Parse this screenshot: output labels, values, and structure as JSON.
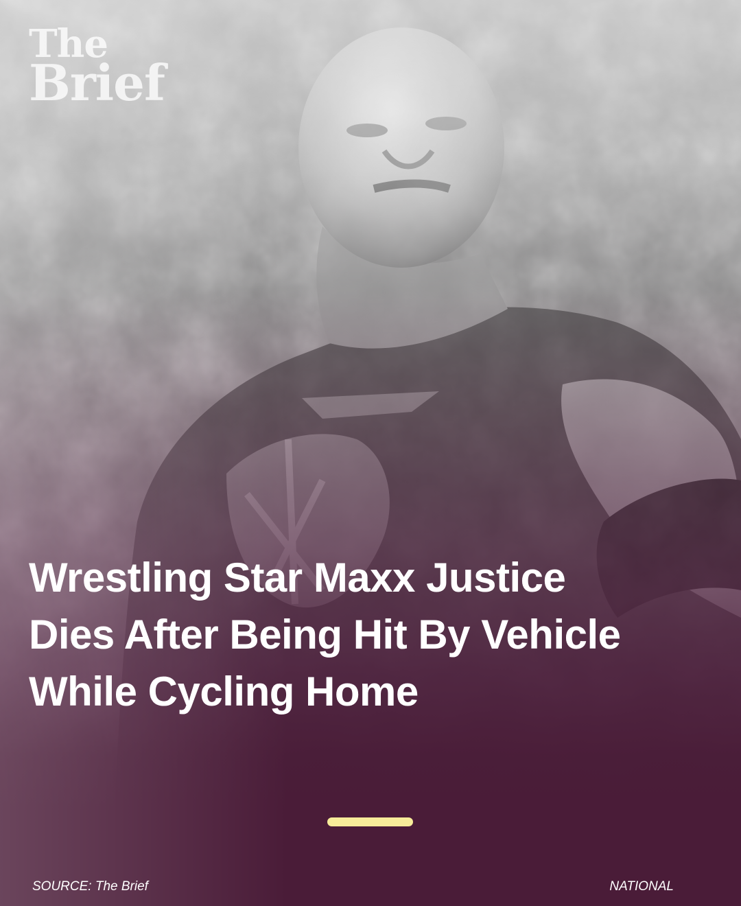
{
  "brand": {
    "logo_line1": "The",
    "logo_line2": "Brief"
  },
  "article": {
    "headline": "Wrestling Star Maxx Justice Dies After Being Hit By Vehicle While Cycling Home"
  },
  "footer": {
    "source": "SOURCE: The Brief",
    "category": "NATIONAL"
  },
  "colors": {
    "background": "#4a1c38",
    "accent": "#f7ec9a",
    "headline_text": "#ffffff"
  }
}
